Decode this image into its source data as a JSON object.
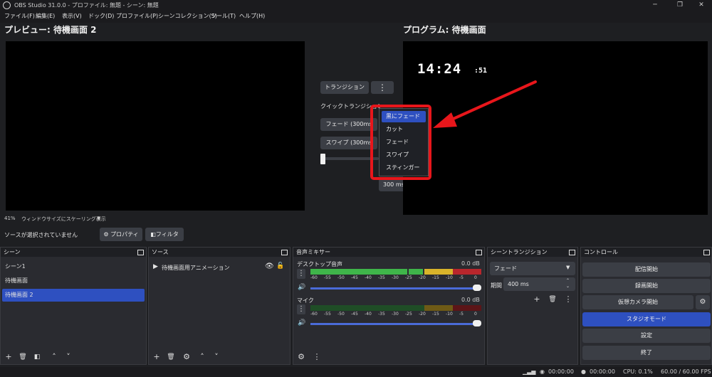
{
  "window": {
    "title": "OBS Studio 31.0.0 - プロファイル: 無題 - シーン: 無題"
  },
  "menu": [
    "ファイル(F)",
    "編集(E)",
    "表示(V)",
    "ドック(D)",
    "プロファイル(P)",
    "シーンコレクション(S)",
    "ツール(T)",
    "ヘルプ(H)"
  ],
  "preview": {
    "title": "プレビュー: 待機画面 2",
    "scale_pct": "41%",
    "scale_mode": "ウィンドウサイズにスケーリング表示"
  },
  "program": {
    "title": "プログラム: 待機画面",
    "clock_main": "14:24",
    "clock_sec": ":51"
  },
  "transition_panel": {
    "transition_button": "トランジション",
    "quick_label": "クイックトランジション",
    "quick_items": [
      "フェード (300ms",
      "スワイプ (300ms"
    ],
    "duration": "300 ms"
  },
  "dropdown": {
    "items": [
      "黒にフェード",
      "カット",
      "フェード",
      "スワイプ",
      "スティンガー"
    ],
    "selected_index": 0
  },
  "source_bar": {
    "status": "ソースが選択されていません",
    "properties": "プロパティ",
    "filters": "フィルタ"
  },
  "scenes": {
    "title": "シーン",
    "items": [
      "シーン1",
      "待機画面",
      "待機画面 2"
    ],
    "selected_index": 2
  },
  "sources": {
    "title": "ソース",
    "items": [
      "待機画面用アニメーション"
    ]
  },
  "mixer": {
    "title": "音声ミキサー",
    "channels": [
      {
        "name": "デスクトップ音声",
        "db": "0.0 dB",
        "level": 0.86
      },
      {
        "name": "マイク",
        "db": "0.0 dB",
        "level": 0.02
      }
    ],
    "ticks": [
      "-60",
      "-55",
      "-50",
      "-45",
      "-40",
      "-35",
      "-30",
      "-25",
      "-20",
      "-15",
      "-10",
      "-5",
      "0"
    ]
  },
  "scene_transitions": {
    "title": "シーントランジション",
    "selected": "フェード",
    "duration_label": "期間",
    "duration": "400 ms"
  },
  "controls": {
    "title": "コントロール",
    "buttons": [
      "配信開始",
      "録画開始",
      "仮想カメラ開始",
      "スタジオモード",
      "設定",
      "終了"
    ],
    "active_index": 3
  },
  "status": {
    "stream_time": "00:00:00",
    "rec_time": "00:00:00",
    "cpu": "CPU: 0.1%",
    "fps": "60.00 / 60.00 FPS"
  },
  "colors": {
    "accent": "#2e50c0",
    "highlight_red": "#e8161b",
    "meter_green": "#3fb54a",
    "meter_yellow": "#d9b42a",
    "meter_red": "#b8262c"
  }
}
